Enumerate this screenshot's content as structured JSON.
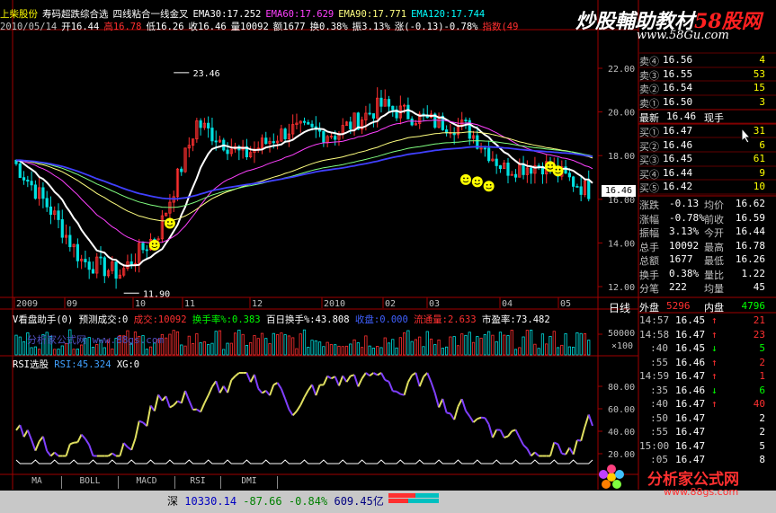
{
  "colors": {
    "up": "#ff3030",
    "down": "#00e0e0",
    "white": "#ffffff",
    "yellow": "#ffff00",
    "magenta": "#ff40ff",
    "blue": "#4040ff",
    "grid": "#a00000",
    "label": "#c0c0c0"
  },
  "title_bar": {
    "stock_name": "上柴股份",
    "formula": "寿码超跌综合选",
    "indicator_name": "四线粘合一线金叉",
    "ema30": "EMA30:17.252",
    "ema60": "EMA60:17.629",
    "ema90": "EMA90:17.771",
    "ema120": "EMA120:17.744"
  },
  "info_bar": {
    "date": "2010/05/14",
    "open": "开16.44",
    "high": "高16.78",
    "low": "低16.26",
    "close": "收16.46",
    "volume": "量10092",
    "amount": "额1677",
    "turnover": "换0.38%",
    "amplitude": "振3.13%",
    "change": "涨(-0.13)-0.78%",
    "index": "指数(49"
  },
  "price_chart": {
    "y_ticks": [
      "22.00",
      "20.00",
      "18.00",
      "16.00",
      "14.00",
      "12.00"
    ],
    "hi_label": "23.46",
    "lo_label": "11.90",
    "last_price": "16.46",
    "x_labels": [
      "2009",
      "09",
      "10",
      "11",
      "12",
      "2010",
      "02",
      "03",
      "04",
      "05"
    ],
    "timeframe": "日线"
  },
  "volume_panel": {
    "title": "V看盘助手(0)",
    "pred": "预测成交:0",
    "vol": "成交:10092",
    "turn": "换手率%:0.383",
    "bai": "百日换手%:43.808",
    "shou": "收盘:0.000",
    "liutong": "流通量:2.633",
    "pe": "市盈率:73.482",
    "ytick": "50000",
    "ytick2": "×100",
    "overlay": "分析家公式网 www.88gs.com"
  },
  "rsi_panel": {
    "title": "RSI选股",
    "rsi": "RSI:45.324",
    "xg": "XG:0",
    "y_ticks": [
      "80.00",
      "60.00",
      "40.00",
      "20.00"
    ]
  },
  "bottom_tabs": [
    "MA",
    "BOLL",
    "MACD",
    "RSI",
    "DMI"
  ],
  "status_bar": {
    "market": "深",
    "index": "10330.14",
    "change": "-87.66",
    "pct": "-0.84%",
    "amount": "609.45亿"
  },
  "order_book": {
    "asks": [
      {
        "label": "卖④",
        "price": "16.56",
        "vol": "4"
      },
      {
        "label": "卖③",
        "price": "16.55",
        "vol": "53"
      },
      {
        "label": "卖②",
        "price": "16.54",
        "vol": "15"
      },
      {
        "label": "卖①",
        "price": "16.50",
        "vol": "3"
      }
    ],
    "latest_label": "最新",
    "latest_price": "16.46",
    "latest_tag": "现手",
    "bids": [
      {
        "label": "买①",
        "price": "16.47",
        "vol": "31"
      },
      {
        "label": "买②",
        "price": "16.46",
        "vol": "6"
      },
      {
        "label": "买③",
        "price": "16.45",
        "vol": "61"
      },
      {
        "label": "买④",
        "price": "16.44",
        "vol": "9"
      },
      {
        "label": "买⑤",
        "price": "16.42",
        "vol": "10"
      }
    ]
  },
  "stats": [
    {
      "l1": "涨跌",
      "v1": "-0.13",
      "l2": "均价",
      "v2": "16.62"
    },
    {
      "l1": "涨幅",
      "v1": "-0.78%",
      "l2": "前收",
      "v2": "16.59"
    },
    {
      "l1": "振幅",
      "v1": "3.13%",
      "l2": "今开",
      "v2": "16.44"
    },
    {
      "l1": "总手",
      "v1": "10092",
      "l2": "最高",
      "v2": "16.78"
    },
    {
      "l1": "总额",
      "v1": "1677",
      "l2": "最低",
      "v2": "16.26"
    },
    {
      "l1": "换手",
      "v1": "0.38%",
      "l2": "量比",
      "v2": "1.22"
    },
    {
      "l1": "分笔",
      "v1": "222",
      "l2": "均量",
      "v2": "45"
    }
  ],
  "outer_inner": {
    "outer_label": "外盘",
    "outer": "5296",
    "inner_label": "内盘",
    "inner": "4796"
  },
  "ticks": [
    {
      "time": "14:57",
      "price": "16.45",
      "dir": "↑",
      "vol": "21"
    },
    {
      "time": "14:58",
      "price": "16.47",
      "dir": "↑",
      "vol": "23"
    },
    {
      "time": ":40",
      "price": "16.45",
      "dir": "↓",
      "vol": "5"
    },
    {
      "time": ":55",
      "price": "16.46",
      "dir": "↑",
      "vol": "2"
    },
    {
      "time": "14:59",
      "price": "16.47",
      "dir": "↑",
      "vol": "1"
    },
    {
      "time": ":35",
      "price": "16.46",
      "dir": "↓",
      "vol": "6"
    },
    {
      "time": ":40",
      "price": "16.47",
      "dir": "↑",
      "vol": "40"
    },
    {
      "time": ":50",
      "price": "16.47",
      "dir": "",
      "vol": "2"
    },
    {
      "time": ":55",
      "price": "16.47",
      "dir": "",
      "vol": "2"
    },
    {
      "time": "15:00",
      "price": "16.47",
      "dir": "",
      "vol": "5"
    },
    {
      "time": ":05",
      "price": "16.47",
      "dir": "",
      "vol": "8"
    }
  ],
  "watermark_top": {
    "text": "炒股輔助教材",
    "brand": "58股网",
    "url": "www.58Gu.com"
  },
  "watermark_bottom": {
    "text": "分析家公式网",
    "url": "www.88gs.com"
  }
}
